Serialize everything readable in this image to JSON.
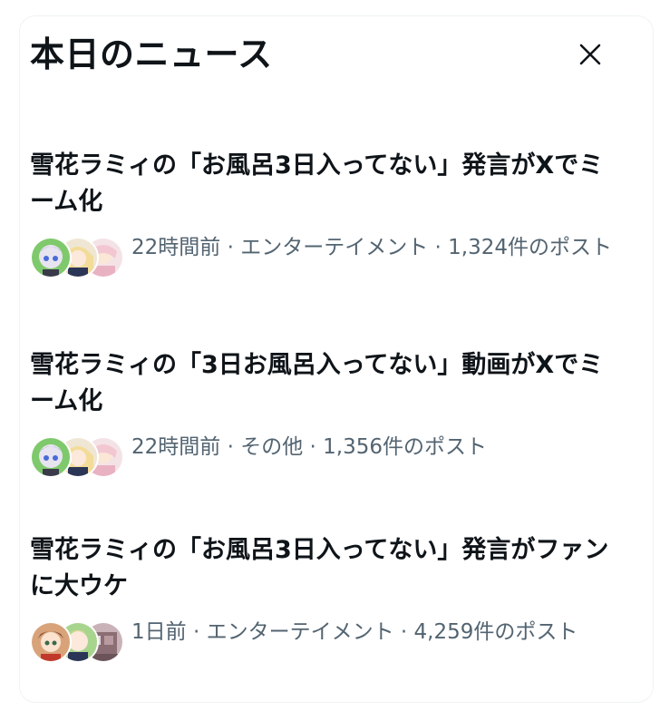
{
  "header": {
    "title": "本日のニュース",
    "close_label": "×"
  },
  "news": [
    {
      "headline": "雪花ラミィの「お風呂3日入ってない」発言がXでミーム化",
      "meta": "22時間前 · エンターテイメント · 1,324件のポスト",
      "avatars": [
        "anime-character-avatar",
        "anime-character-avatar",
        "anime-character-avatar"
      ]
    },
    {
      "headline": "雪花ラミィの「3日お風呂入ってない」動画がXでミーム化",
      "meta": "22時間前 · その他 · 1,356件のポスト",
      "avatars": [
        "anime-character-avatar",
        "anime-character-avatar",
        "anime-character-avatar"
      ]
    },
    {
      "headline": "雪花ラミィの「お風呂3日入ってない」発言がファンに大ウケ",
      "meta": "1日前 · エンターテイメント · 4,259件のポスト",
      "avatars": [
        "anime-character-avatar",
        "anime-character-avatar",
        "room-photo-avatar"
      ]
    }
  ],
  "colors": {
    "text_primary": "#0f1419",
    "text_secondary": "#536471",
    "border": "#eff3f4",
    "background": "#ffffff"
  }
}
